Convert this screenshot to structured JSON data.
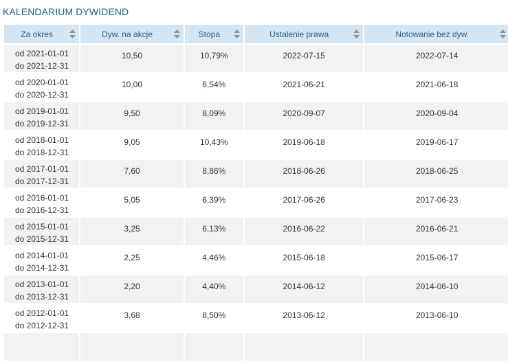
{
  "title": "KALENDARIUM DYWIDEND",
  "columns": [
    "Za okres",
    "Dyw. na akcje",
    "Stopa",
    "Ustalenie prawa",
    "Notowanie bez dyw."
  ],
  "rows": [
    {
      "from": "od 2021-01-01",
      "to": "do 2021-12-31",
      "dividend": "10,50",
      "yield": "10,79%",
      "record_date": "2022-07-15",
      "ex_date": "2022-07-14"
    },
    {
      "from": "od 2020-01-01",
      "to": "do 2020-12-31",
      "dividend": "10,00",
      "yield": "6,54%",
      "record_date": "2021-06-21",
      "ex_date": "2021-06-18"
    },
    {
      "from": "od 2019-01-01",
      "to": "do 2019-12-31",
      "dividend": "9,50",
      "yield": "8,09%",
      "record_date": "2020-09-07",
      "ex_date": "2020-09-04"
    },
    {
      "from": "od 2018-01-01",
      "to": "do 2018-12-31",
      "dividend": "9,05",
      "yield": "10,43%",
      "record_date": "2019-06-18",
      "ex_date": "2019-06-17"
    },
    {
      "from": "od 2017-01-01",
      "to": "do 2017-12-31",
      "dividend": "7,60",
      "yield": "8,86%",
      "record_date": "2018-06-26",
      "ex_date": "2018-06-25"
    },
    {
      "from": "od 2016-01-01",
      "to": "do 2016-12-31",
      "dividend": "5,05",
      "yield": "6,39%",
      "record_date": "2017-06-26",
      "ex_date": "2017-06-23"
    },
    {
      "from": "od 2015-01-01",
      "to": "do 2015-12-31",
      "dividend": "3,25",
      "yield": "6,13%",
      "record_date": "2016-06-22",
      "ex_date": "2016-06-21"
    },
    {
      "from": "od 2014-01-01",
      "to": "do 2014-12-31",
      "dividend": "2,25",
      "yield": "4,46%",
      "record_date": "2015-06-18",
      "ex_date": "2015-06-17"
    },
    {
      "from": "od 2013-01-01",
      "to": "do 2013-12-31",
      "dividend": "2,20",
      "yield": "4,40%",
      "record_date": "2014-06-12",
      "ex_date": "2014-06-10"
    },
    {
      "from": "od 2012-01-01",
      "to": "do 2012-12-31",
      "dividend": "3,68",
      "yield": "8,50%",
      "record_date": "2013-06-12",
      "ex_date": "2013-06-10"
    }
  ],
  "icons": {
    "sort": "sort-arrows-icon"
  },
  "colors": {
    "title": "#1f5f8e",
    "header_bg": "#d4e5f3",
    "header_text": "#2c5f85",
    "row_alt_bg": "#f2f2f2",
    "text": "#333333"
  }
}
